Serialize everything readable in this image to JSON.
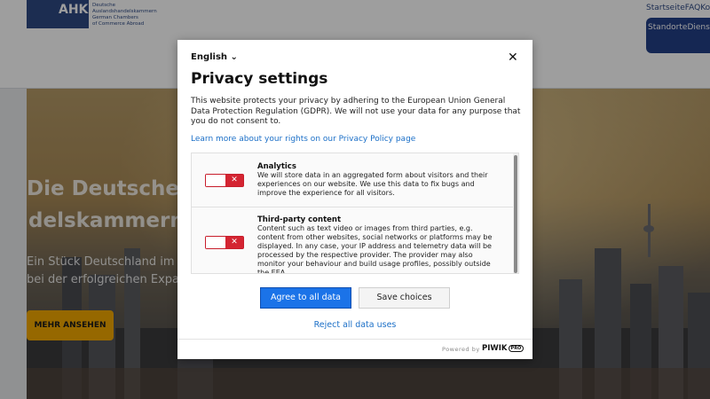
{
  "site": {
    "logo_brand": "AHK",
    "logo_lines": [
      "Deutsche",
      "Auslandshandelskammern",
      "German Chambers",
      "of Commerce Abroad"
    ],
    "top_nav": [
      "Startseite",
      "FAQ",
      "Kont"
    ],
    "nav_button": "StandorteDienst",
    "hero_title_1": "Die Deutsche",
    "hero_title_2": "delskammern",
    "hero_sub_1": "Ein Stück Deutschland im Aus",
    "hero_sub_2": "bei der  erfolgreichen Expansic",
    "hero_cta": "MEHR ANSEHEN"
  },
  "modal": {
    "language": "English",
    "close_label": "✕",
    "title": "Privacy settings",
    "intro": "This website protects your privacy by adhering to the European Union General Data Protection Regulation (GDPR). We will not use your data for any purpose that you do not consent to.",
    "learn_more": "Learn more about your rights on our Privacy Policy page",
    "consents": [
      {
        "title": "Analytics",
        "description": "We will store data in an aggregated form about visitors and their experiences on our website. We use this data to fix bugs and improve the experience for all visitors.",
        "enabled": false
      },
      {
        "title": "Third-party content",
        "description": "Content such as text video or images from third parties, e.g. content from other websites, social networks or platforms may be displayed. In any case, your IP address and telemetry data will be processed by the respective provider. The provider may also monitor your behaviour and build usage profiles, possibly outside the EEA.",
        "enabled": false
      }
    ],
    "toggle_off_icon": "✕",
    "agree_button": "Agree to all data uses",
    "save_button": "Save choices",
    "reject_button": "Reject all data uses",
    "powered_by": "Powered by",
    "piwik": "PIWIK",
    "pro": "PRO"
  },
  "colors": {
    "primary_blue": "#1b73e8",
    "link_blue": "#1b6fc7",
    "toggle_red": "#d42532",
    "brand_navy": "#2e4a84",
    "cta_yellow": "#f2a900"
  }
}
